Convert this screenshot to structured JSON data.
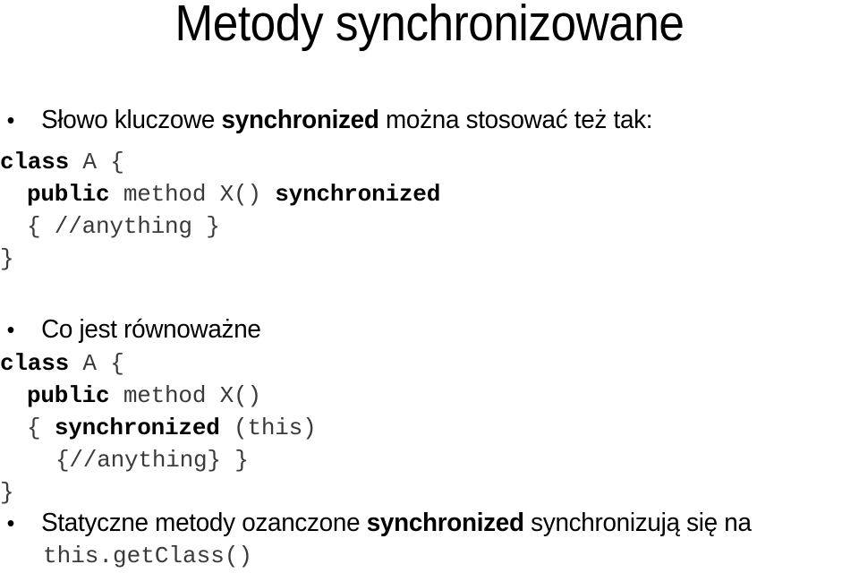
{
  "slide": {
    "title": "Metody synchronizowane",
    "bullet_marker": "•"
  },
  "bullet1": {
    "text_before": "Słowo kluczowe ",
    "keyword": "synchronized",
    "text_after": " można stosować też tak:"
  },
  "code_block_1": {
    "lines": [
      {
        "indent": 0,
        "segments": [
          {
            "text": "class",
            "style": "kw"
          },
          {
            "text": " A {",
            "style": "plain"
          }
        ]
      },
      {
        "indent": 30,
        "segments": [
          {
            "text": "public",
            "style": "kw"
          },
          {
            "text": " method X() ",
            "style": "plain"
          },
          {
            "text": "synchronized",
            "style": "kw"
          }
        ]
      },
      {
        "indent": 30,
        "segments": [
          {
            "text": "{ //anything }",
            "style": "plain"
          }
        ]
      },
      {
        "indent": 0,
        "segments": [
          {
            "text": "}",
            "style": "plain"
          }
        ]
      }
    ]
  },
  "bullet2": {
    "text_before": "Co jest równoważne",
    "keyword": "",
    "text_after": ""
  },
  "code_block_2": {
    "lines": [
      {
        "indent": 0,
        "segments": [
          {
            "text": "class",
            "style": "kw"
          },
          {
            "text": " A {",
            "style": "plain"
          }
        ]
      },
      {
        "indent": 30,
        "segments": [
          {
            "text": "public",
            "style": "kw"
          },
          {
            "text": " method X()",
            "style": "plain"
          }
        ]
      },
      {
        "indent": 30,
        "segments": [
          {
            "text": "{ ",
            "style": "plain"
          },
          {
            "text": "synchronized",
            "style": "kw"
          },
          {
            "text": " (this)",
            "style": "plain"
          }
        ]
      },
      {
        "indent": 62,
        "segments": [
          {
            "text": "{//anything} }",
            "style": "plain"
          }
        ]
      },
      {
        "indent": 0,
        "segments": [
          {
            "text": "}",
            "style": "plain"
          }
        ]
      }
    ]
  },
  "bullet3": {
    "text_before": "Statyczne metody ozanczone ",
    "keyword": "synchronized",
    "text_after": " synchronizują się na"
  },
  "code_block_3": {
    "text": "this.getClass()"
  }
}
